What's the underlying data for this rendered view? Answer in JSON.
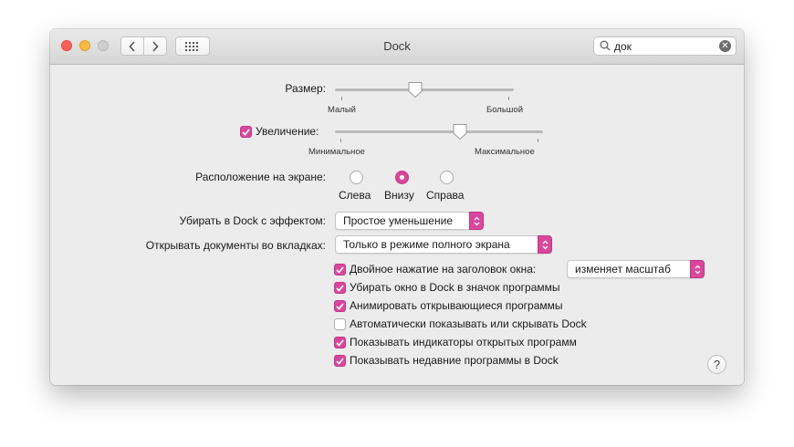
{
  "window": {
    "title": "Dock"
  },
  "search": {
    "value": "док"
  },
  "size": {
    "label": "Размер:",
    "min_label": "Малый",
    "max_label": "Большой",
    "value": 0.45
  },
  "magnification": {
    "label": "Увеличение:",
    "checked": true,
    "min_label": "Минимальное",
    "max_label": "Максимальное",
    "value": 0.6
  },
  "position": {
    "label": "Расположение на экране:",
    "options": [
      "Слева",
      "Внизу",
      "Справа"
    ],
    "selected": "Внизу"
  },
  "minimize_effect": {
    "label": "Убирать в Dock с эффектом:",
    "value": "Простое уменьшение"
  },
  "tabs": {
    "label": "Открывать документы во вкладках:",
    "value": "Только в режиме полного экрана"
  },
  "double_click": {
    "label": "Двойное нажатие на заголовок окна:",
    "checked": true,
    "value": "изменяет масштаб"
  },
  "checkboxes": [
    {
      "label": "Убирать окно в Dock в значок программы",
      "checked": true
    },
    {
      "label": "Анимировать открывающиеся программы",
      "checked": true
    },
    {
      "label": "Автоматически показывать или скрывать Dock",
      "checked": false
    },
    {
      "label": "Показывать индикаторы открытых программ",
      "checked": true
    },
    {
      "label": "Показывать недавние программы в Dock",
      "checked": true
    }
  ],
  "help": {
    "label": "?"
  },
  "colors": {
    "accent": "#d9479d"
  }
}
